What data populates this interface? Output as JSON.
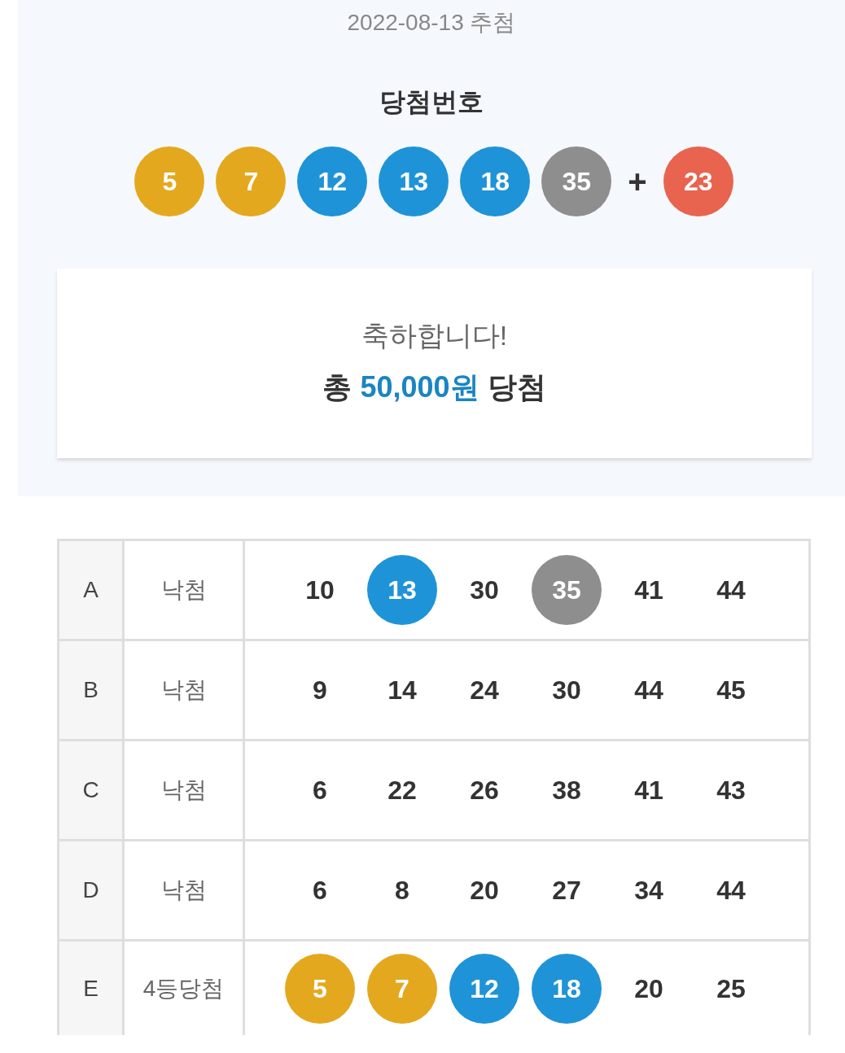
{
  "draw": {
    "date": "2022-08-13 추첨",
    "title": "당첨번호",
    "numbers": [
      {
        "value": "5",
        "color": "#e4a81f"
      },
      {
        "value": "7",
        "color": "#e4a81f"
      },
      {
        "value": "12",
        "color": "#1f93d7"
      },
      {
        "value": "13",
        "color": "#1f93d7"
      },
      {
        "value": "18",
        "color": "#1f93d7"
      },
      {
        "value": "35",
        "color": "#8e8e8e"
      }
    ],
    "plus": "+",
    "bonus": {
      "value": "23",
      "color": "#e8644f"
    }
  },
  "result_card": {
    "greeting": "축하합니다!",
    "prefix": "총",
    "amount": "50,000원",
    "suffix": "당첨"
  },
  "tickets": [
    {
      "label": "A",
      "result": "낙첨",
      "numbers": [
        {
          "value": "10",
          "matched": false
        },
        {
          "value": "13",
          "matched": true,
          "color": "#1f93d7"
        },
        {
          "value": "30",
          "matched": false
        },
        {
          "value": "35",
          "matched": true,
          "color": "#8e8e8e"
        },
        {
          "value": "41",
          "matched": false
        },
        {
          "value": "44",
          "matched": false
        }
      ]
    },
    {
      "label": "B",
      "result": "낙첨",
      "numbers": [
        {
          "value": "9",
          "matched": false
        },
        {
          "value": "14",
          "matched": false
        },
        {
          "value": "24",
          "matched": false
        },
        {
          "value": "30",
          "matched": false
        },
        {
          "value": "44",
          "matched": false
        },
        {
          "value": "45",
          "matched": false
        }
      ]
    },
    {
      "label": "C",
      "result": "낙첨",
      "numbers": [
        {
          "value": "6",
          "matched": false
        },
        {
          "value": "22",
          "matched": false
        },
        {
          "value": "26",
          "matched": false
        },
        {
          "value": "38",
          "matched": false
        },
        {
          "value": "41",
          "matched": false
        },
        {
          "value": "43",
          "matched": false
        }
      ]
    },
    {
      "label": "D",
      "result": "낙첨",
      "numbers": [
        {
          "value": "6",
          "matched": false
        },
        {
          "value": "8",
          "matched": false
        },
        {
          "value": "20",
          "matched": false
        },
        {
          "value": "27",
          "matched": false
        },
        {
          "value": "34",
          "matched": false
        },
        {
          "value": "44",
          "matched": false
        }
      ]
    },
    {
      "label": "E",
      "result": "4등당첨",
      "numbers": [
        {
          "value": "5",
          "matched": true,
          "color": "#e4a81f"
        },
        {
          "value": "7",
          "matched": true,
          "color": "#e4a81f"
        },
        {
          "value": "12",
          "matched": true,
          "color": "#1f93d7"
        },
        {
          "value": "18",
          "matched": true,
          "color": "#1f93d7"
        },
        {
          "value": "20",
          "matched": false
        },
        {
          "value": "25",
          "matched": false
        }
      ]
    }
  ]
}
